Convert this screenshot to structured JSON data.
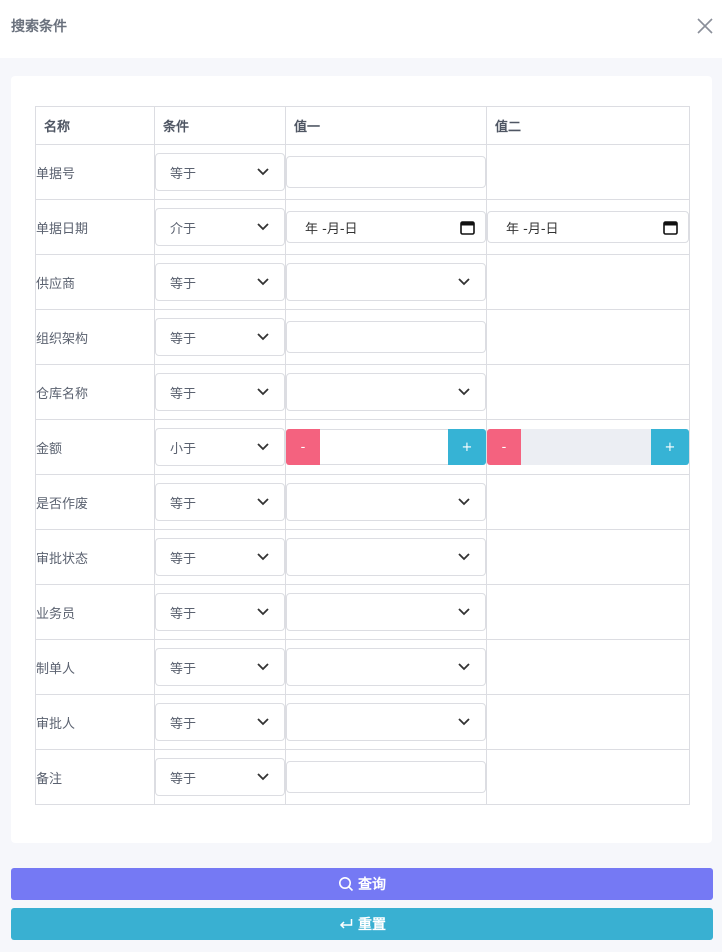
{
  "dialog": {
    "title": "搜索条件"
  },
  "table": {
    "headers": [
      "名称",
      "条件",
      "值一",
      "值二"
    ],
    "date_placeholder": "年 -月-日",
    "stepper_minus": "-",
    "stepper_plus": "+",
    "rows": [
      {
        "name": "单据号",
        "condition": "等于",
        "value1": "input",
        "value2": "none"
      },
      {
        "name": "单据日期",
        "condition": "介于",
        "value1": "date",
        "value2": "date"
      },
      {
        "name": "供应商",
        "condition": "等于",
        "value1": "select",
        "value2": "none"
      },
      {
        "name": "组织架构",
        "condition": "等于",
        "value1": "input",
        "value2": "none"
      },
      {
        "name": "仓库名称",
        "condition": "等于",
        "value1": "select",
        "value2": "none"
      },
      {
        "name": "金额",
        "condition": "小于",
        "value1": "stepper",
        "value2": "stepper-disabled"
      },
      {
        "name": "是否作废",
        "condition": "等于",
        "value1": "select",
        "value2": "none"
      },
      {
        "name": "审批状态",
        "condition": "等于",
        "value1": "select",
        "value2": "none"
      },
      {
        "name": "业务员",
        "condition": "等于",
        "value1": "select",
        "value2": "none"
      },
      {
        "name": "制单人",
        "condition": "等于",
        "value1": "select",
        "value2": "none"
      },
      {
        "name": "审批人",
        "condition": "等于",
        "value1": "select",
        "value2": "none"
      },
      {
        "name": "备注",
        "condition": "等于",
        "value1": "input",
        "value2": "none"
      }
    ]
  },
  "buttons": {
    "search_label": "查询",
    "reset_label": "重置"
  },
  "icons": {
    "close": "close-icon",
    "chevron": "chevron-down-icon",
    "calendar": "calendar-icon",
    "search": "search-icon",
    "reset": "return-icon"
  },
  "colors": {
    "search_button": "#7579f4",
    "reset_button": "#39b0d2",
    "stepper_minus": "#f4627f",
    "stepper_plus": "#36b3d5"
  }
}
